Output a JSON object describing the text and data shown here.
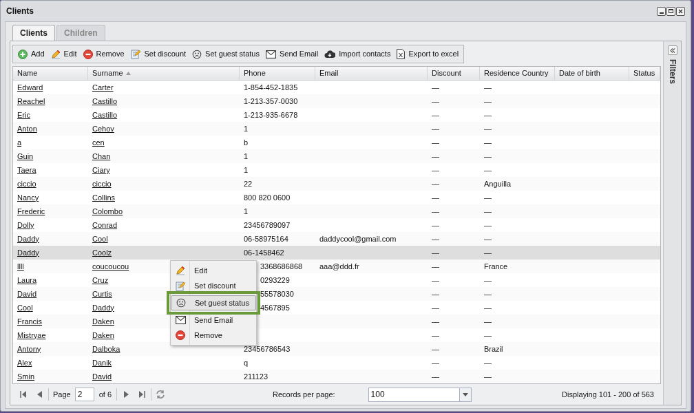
{
  "window": {
    "title": "Clients"
  },
  "tabs": [
    {
      "label": "Clients",
      "selected": true
    },
    {
      "label": "Children",
      "selected": false
    }
  ],
  "toolbar": [
    {
      "label": "Add",
      "kind": "add"
    },
    {
      "label": "Edit",
      "kind": "edit"
    },
    {
      "label": "Remove",
      "kind": "remove"
    },
    {
      "label": "Set discount",
      "kind": "discount"
    },
    {
      "label": "Set guest status",
      "kind": "guest"
    },
    {
      "label": "Send Email",
      "kind": "email"
    },
    {
      "label": "Import contacts",
      "kind": "import"
    },
    {
      "label": "Export to excel",
      "kind": "excel"
    }
  ],
  "table": {
    "columns": [
      {
        "label": "Name"
      },
      {
        "label": "Surname",
        "sorted": true
      },
      {
        "label": "Phone"
      },
      {
        "label": "Email"
      },
      {
        "label": "Discount"
      },
      {
        "label": "Residence Country"
      },
      {
        "label": "Date of birth"
      },
      {
        "label": "Status"
      }
    ],
    "rows": [
      {
        "name": "Edward",
        "surname": "Carter",
        "phone": "1-854-452-1835",
        "discount": "—",
        "country": "—",
        "selected": false
      },
      {
        "name": "Reachel",
        "surname": "Castillo",
        "phone": "1-213-357-0030",
        "discount": "—",
        "country": "—",
        "selected": false
      },
      {
        "name": "Eric",
        "surname": "Castillo",
        "phone": "1-213-935-6678",
        "discount": "—",
        "country": "—",
        "selected": false
      },
      {
        "name": "Anton",
        "surname": "Cehov",
        "phone": "1",
        "discount": "—",
        "country": "—",
        "selected": false
      },
      {
        "name": "a",
        "surname": "cen",
        "phone": "b",
        "discount": "—",
        "country": "—",
        "selected": false
      },
      {
        "name": "Guin",
        "surname": "Chan",
        "phone": "1",
        "discount": "—",
        "country": "—",
        "selected": false
      },
      {
        "name": "Taera",
        "surname": "Ciary",
        "phone": "1",
        "discount": "—",
        "country": "—",
        "selected": false
      },
      {
        "name": "ciccio",
        "surname": "ciccio",
        "phone": "22",
        "discount": "—",
        "country": "Anguilla",
        "selected": false
      },
      {
        "name": "Nancy",
        "surname": "Collins",
        "phone": "800 820 0600",
        "discount": "—",
        "country": "—",
        "selected": false
      },
      {
        "name": "Frederic",
        "surname": "Colombo",
        "phone": "1",
        "discount": "—",
        "country": "—",
        "selected": false
      },
      {
        "name": "Dolly",
        "surname": "Conrad",
        "phone": "23456789097",
        "discount": "—",
        "country": "—",
        "selected": false
      },
      {
        "name": "Daddy",
        "surname": "Cool",
        "phone": "06-58975164",
        "email": "daddycool@gmail.com",
        "discount": "—",
        "country": "—",
        "selected": false
      },
      {
        "name": "Daddy",
        "surname": "Coolz",
        "phone": "06-1458462",
        "discount": "—",
        "country": "—",
        "selected": true
      },
      {
        "name": "llll",
        "surname": "coucoucou",
        "phone": "3368686868",
        "phone_covered": true,
        "email": "aaa@ddd.fr",
        "discount": "—",
        "country": "France",
        "selected": false
      },
      {
        "name": "Laura",
        "surname": "Cruz",
        "phone": "0293229",
        "phone_covered": true,
        "discount": "—",
        "country": "—",
        "selected": false
      },
      {
        "name": "David",
        "surname": "Curtis",
        "phone": "55578030",
        "phone_covered": true,
        "discount": "—",
        "country": "—",
        "selected": false
      },
      {
        "name": "Cool",
        "surname": "Daddy",
        "phone": "4567895",
        "phone_covered": true,
        "discount": "—",
        "country": "—",
        "selected": false
      },
      {
        "name": "Francis",
        "surname": "Daken",
        "discount": "—",
        "country": "—",
        "selected": false
      },
      {
        "name": "Mistryae",
        "surname": "Daken",
        "discount": "—",
        "country": "—",
        "selected": false
      },
      {
        "name": "Antony",
        "surname": "Dalboka",
        "phone": "23456786543",
        "discount": "—",
        "country": "Brazil",
        "selected": false
      },
      {
        "name": "Alex",
        "surname": "Danik",
        "phone": "q",
        "discount": "—",
        "country": "—",
        "selected": false
      },
      {
        "name": "Smin",
        "surname": "David",
        "phone": "211123",
        "discount": "—",
        "country": "—",
        "selected": false
      }
    ]
  },
  "context_menu": {
    "items": [
      {
        "label": "Edit",
        "kind": "edit",
        "selected": false
      },
      {
        "label": "Set discount",
        "kind": "discount",
        "selected": false
      },
      {
        "label": "Set guest status",
        "kind": "guest",
        "selected": true
      },
      {
        "label": "Send Email",
        "kind": "email",
        "selected": false
      },
      {
        "label": "Remove",
        "kind": "remove",
        "selected": false
      }
    ]
  },
  "filters": {
    "label": "Filters"
  },
  "pager": {
    "page_label": "Page",
    "page": "2",
    "of": "of 6",
    "records_label": "Records per page:",
    "per_page": "100",
    "display": "Displaying 101 - 200 of 563"
  }
}
